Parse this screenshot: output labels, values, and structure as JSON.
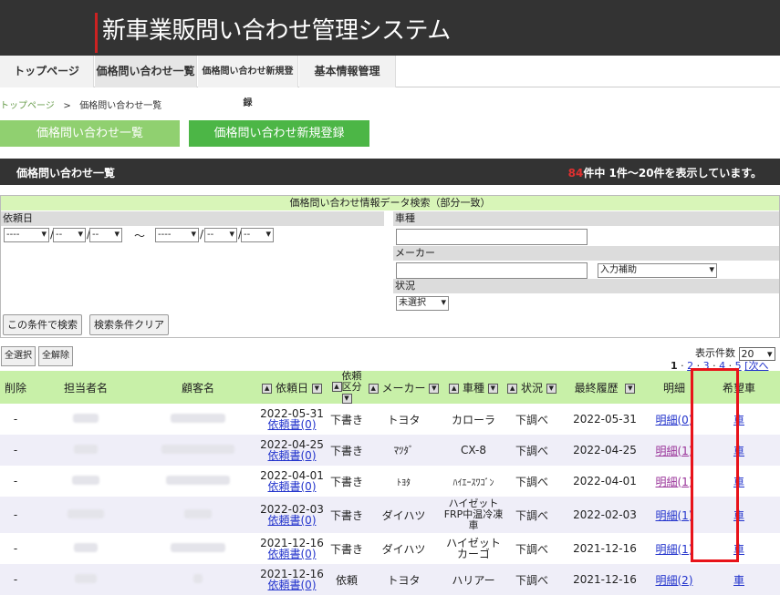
{
  "app": {
    "title": "新車業販問い合わせ管理システム"
  },
  "nav": {
    "tabs": [
      {
        "label": "トップページ"
      },
      {
        "label": "価格問い合わせ一覧"
      },
      {
        "label": "価格問い合わせ新規登録"
      },
      {
        "label": "基本情報管理"
      }
    ]
  },
  "breadcrumb": {
    "home": "トップページ",
    "sep": ">",
    "current": "価格問い合わせ一覧"
  },
  "buttons": {
    "list": "価格問い合わせ一覧",
    "new": "価格問い合わせ新規登録"
  },
  "section": {
    "title": "価格問い合わせ一覧",
    "count": "84",
    "count_text": "件中 1件～20件を表示しています。"
  },
  "search": {
    "header": "価格問い合わせ情報データ検索（部分一致）",
    "date_label": "依頼日",
    "date_sel": "----",
    "date_sel_small": "--",
    "tilde": "～",
    "car_label": "車種",
    "maker_label": "メーカー",
    "maker_assist": "入力補助",
    "status_label": "状況",
    "status_value": "未選択",
    "search_btn": "この条件で検索",
    "clear_btn": "検索条件クリア"
  },
  "list_controls": {
    "select_all": "全選択",
    "deselect_all": "全解除",
    "perpage_label": "表示件数",
    "perpage_value": "20"
  },
  "pager": {
    "current": "1",
    "pages": [
      "2",
      "3",
      "4",
      "5"
    ],
    "next": "[次へ"
  },
  "table": {
    "headers": {
      "delete": "削除",
      "staff": "担当者名",
      "customer": "顧客名",
      "date": "依頼日",
      "type": "依頼区分",
      "maker": "メーカー",
      "car": "車種",
      "status": "状況",
      "history": "最終履歴",
      "detail": "明細",
      "wish": "希望車"
    },
    "rows": [
      {
        "del": "-",
        "date": "2022-05-31",
        "doc": "依頼書(0)",
        "type": "下書き",
        "maker": "トヨタ",
        "car": "カローラ",
        "status": "下調べ",
        "history": "2022-05-31",
        "detail": "明細(0)",
        "wish": "車"
      },
      {
        "del": "-",
        "date": "2022-04-25",
        "doc": "依頼書(0)",
        "type": "下書き",
        "maker": "ﾏﾂﾀﾞ",
        "car": "CX-8",
        "status": "下調べ",
        "history": "2022-04-25",
        "detail": "明細(1)",
        "wish": "車"
      },
      {
        "del": "-",
        "date": "2022-04-01",
        "doc": "依頼書(0)",
        "type": "下書き",
        "maker": "ﾄﾖﾀ",
        "car": "ﾊｲｴｰｽﾜｺﾞﾝ",
        "status": "下調べ",
        "history": "2022-04-01",
        "detail": "明細(1)",
        "wish": "車"
      },
      {
        "del": "-",
        "date": "2022-02-03",
        "doc": "依頼書(0)",
        "type": "下書き",
        "maker": "ダイハツ",
        "car": "ハイゼットFRP中温冷凍車",
        "status": "下調べ",
        "history": "2022-02-03",
        "detail": "明細(1)",
        "wish": "車"
      },
      {
        "del": "-",
        "date": "2021-12-16",
        "doc": "依頼書(0)",
        "type": "下書き",
        "maker": "ダイハツ",
        "car": "ハイゼットカーゴ",
        "status": "下調べ",
        "history": "2021-12-16",
        "detail": "明細(1)",
        "wish": "車"
      },
      {
        "del": "-",
        "date": "2021-12-16",
        "doc": "依頼書(0)",
        "type": "依頼",
        "maker": "トヨタ",
        "car": "ハリアー",
        "status": "下調べ",
        "history": "2021-12-16",
        "detail": "明細(2)",
        "wish": "車"
      }
    ]
  },
  "colors": {
    "header_bg": "#333333",
    "accent_red": "#cc2222",
    "green_light": "#90d070",
    "green_strong": "#4cb646",
    "table_head": "#c8f0a8",
    "highlight": "#e8131a"
  }
}
